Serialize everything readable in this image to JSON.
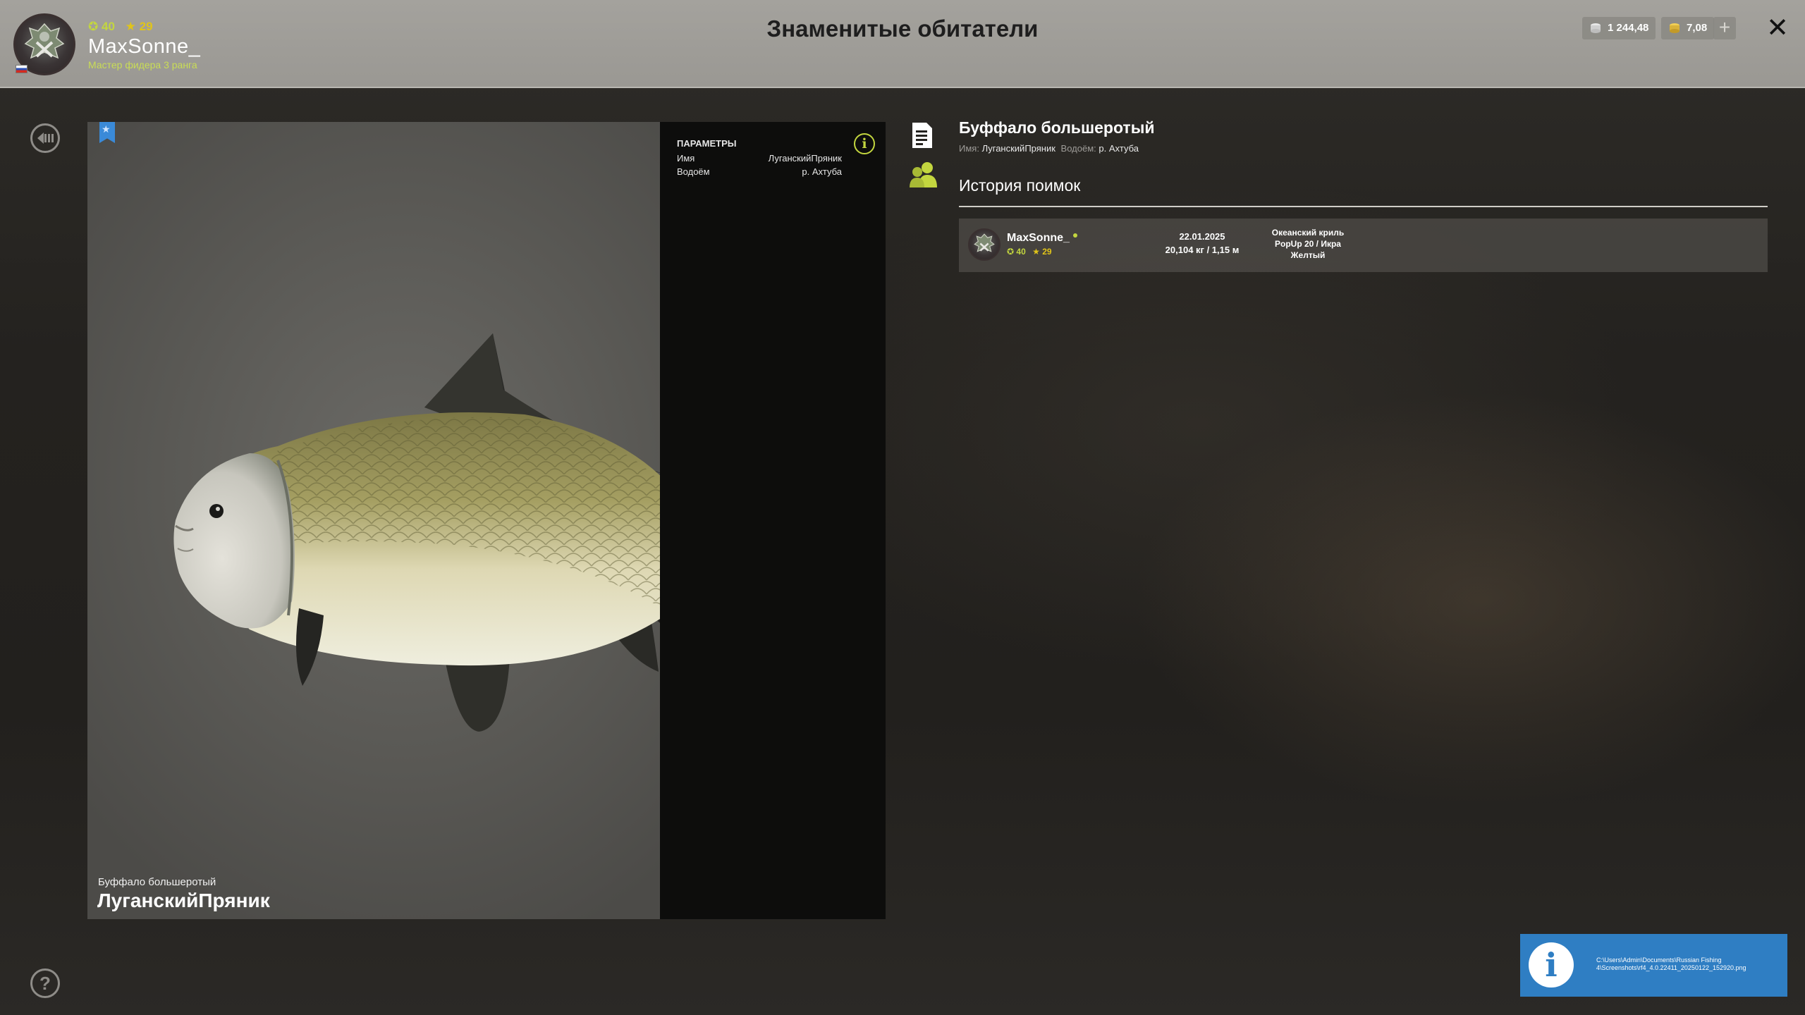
{
  "header": {
    "title": "Знаменитые обитатели",
    "user": {
      "name": "MaxSonne_",
      "level": "40",
      "stars": "29",
      "rank": "Мастер фидера 3 ранга"
    },
    "currency": {
      "silver": "1 244,48",
      "gold": "7,08"
    },
    "add_label": "+",
    "close_label": "✕"
  },
  "fish_card": {
    "species": "Буффало большеротый",
    "name": "ЛуганскийПряник",
    "params": {
      "title": "ПАРАМЕТРЫ",
      "name_label": "Имя",
      "name_value": "ЛуганскийПряник",
      "water_label": "Водоём",
      "water_value": "р. Ахтуба",
      "info_glyph": "i"
    }
  },
  "details": {
    "species": "Буффало большеротый",
    "meta": {
      "name_label": "Имя:",
      "name_value": "ЛуганскийПряник",
      "water_label": "Водоём:",
      "water_value": "р. Ахтуба"
    },
    "history_title": "История поимок",
    "history": [
      {
        "user": "MaxSonne_",
        "level": "40",
        "stars": "29",
        "date": "22.01.2025",
        "catch": "20,104 кг  / 1,15 м",
        "bait_line1": "Океанский криль",
        "bait_line2": "PopUp 20  /  Икра",
        "bait_line3": "Желтый"
      }
    ]
  },
  "toast": {
    "glyph": "i",
    "text": "C:\\Users\\Admin\\Documents\\Russian Fishing 4\\Screenshots\\rf4_4.0.22411_20250122_152920.png"
  },
  "colors": {
    "accent_green": "#c3d63f",
    "rank_green": "#c9dd55",
    "star_yellow": "#e0c419",
    "bookmark_blue": "#3a8ad8",
    "toast_blue": "#2f7ec3"
  },
  "icons": {
    "back": "back-icon",
    "help": "help-icon",
    "bookmark": "bookmark-icon",
    "info": "info-icon",
    "document": "document-icon",
    "group": "group-icon",
    "silver_coin": "silver-coin-icon",
    "gold_coin": "gold-coin-icon",
    "close": "close-icon",
    "plus": "plus-icon"
  }
}
